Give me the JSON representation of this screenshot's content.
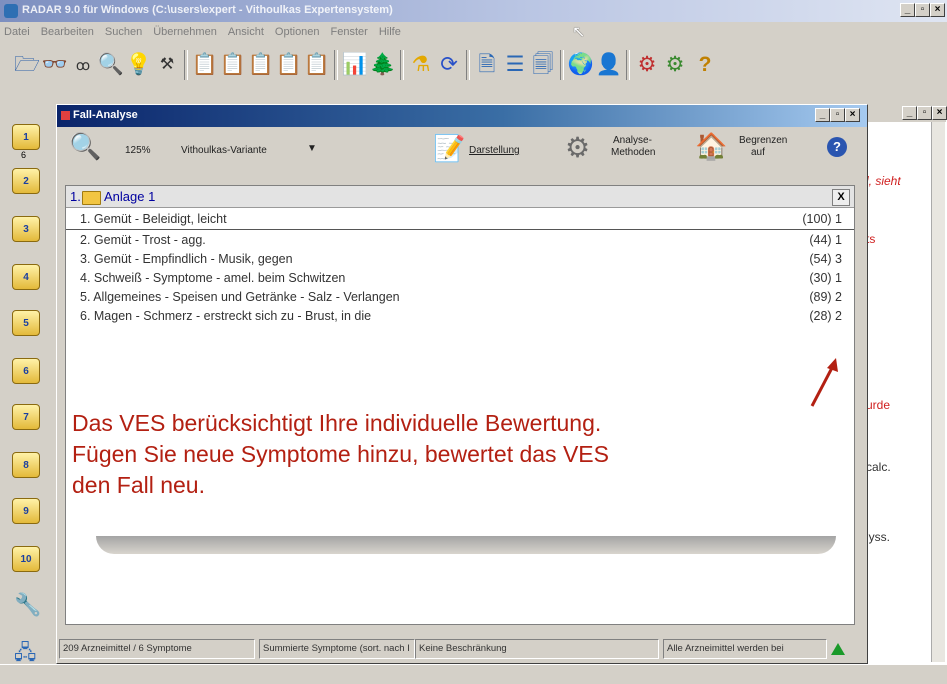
{
  "window": {
    "title": "RADAR 9.0 für Windows (C:\\users\\expert - Vithoulkas Expertensystem)"
  },
  "menu": [
    "Datei",
    "Bearbeiten",
    "Suchen",
    "Übernehmen",
    "Ansicht",
    "Optionen",
    "Fenster",
    "Hilfe"
  ],
  "left_toolbar": [
    "1",
    "2",
    "3",
    "4",
    "5",
    "6",
    "7",
    "8",
    "9",
    "10"
  ],
  "left_toolbar_small": "6",
  "fall_analyse": {
    "title": "Fall-Analyse",
    "zoom": "125%",
    "variant": "Vithoulkas-Variante",
    "darstellung": "Darstellung",
    "analyse_line1": "Analyse-",
    "analyse_line2": "Methoden",
    "begrenzen_line1": "Begrenzen",
    "begrenzen_line2": "auf"
  },
  "list": {
    "header_num": "1.",
    "header_label": "Anlage 1",
    "close": "X",
    "rows": [
      {
        "text": "1. Gemüt - Beleidigt, leicht",
        "value": "(100) 1"
      },
      {
        "text": "2. Gemüt - Trost - agg.",
        "value": "(44) 1"
      },
      {
        "text": "3. Gemüt - Empfindlich - Musik, gegen",
        "value": "(54) 3"
      },
      {
        "text": "4. Schweiß - Symptome - amel. beim Schwitzen",
        "value": "(30) 1"
      },
      {
        "text": "5. Allgemeines - Speisen und Getränke - Salz - Verlangen",
        "value": "(89) 2"
      },
      {
        "text": "6. Magen - Schmerz - erstreckt sich zu - Brust, in die",
        "value": "(28) 2"
      }
    ]
  },
  "callout": {
    "line1": "Das VES berücksichtigt Ihre individuelle Bewertung.",
    "line2": "Fügen Sie neue Symptome hinzu, bewertet das VES",
    "line3": "den Fall neu."
  },
  "status": {
    "s1": "209 Arzneimittel / 6 Symptome",
    "s2": "Summierte Symptome (sort. nach I",
    "s3": "Keine Beschränkung",
    "s4": "Alle Arzneimittel werden bei"
  },
  "right_doc": {
    "t1": "l, sieht",
    "t2": "ts",
    "t3": "urde",
    "t4": "calc.",
    "t5": "lyss."
  },
  "colors": {
    "callout": "#b32012",
    "title_active": "#0a246a",
    "list_header": "#0000a0"
  }
}
